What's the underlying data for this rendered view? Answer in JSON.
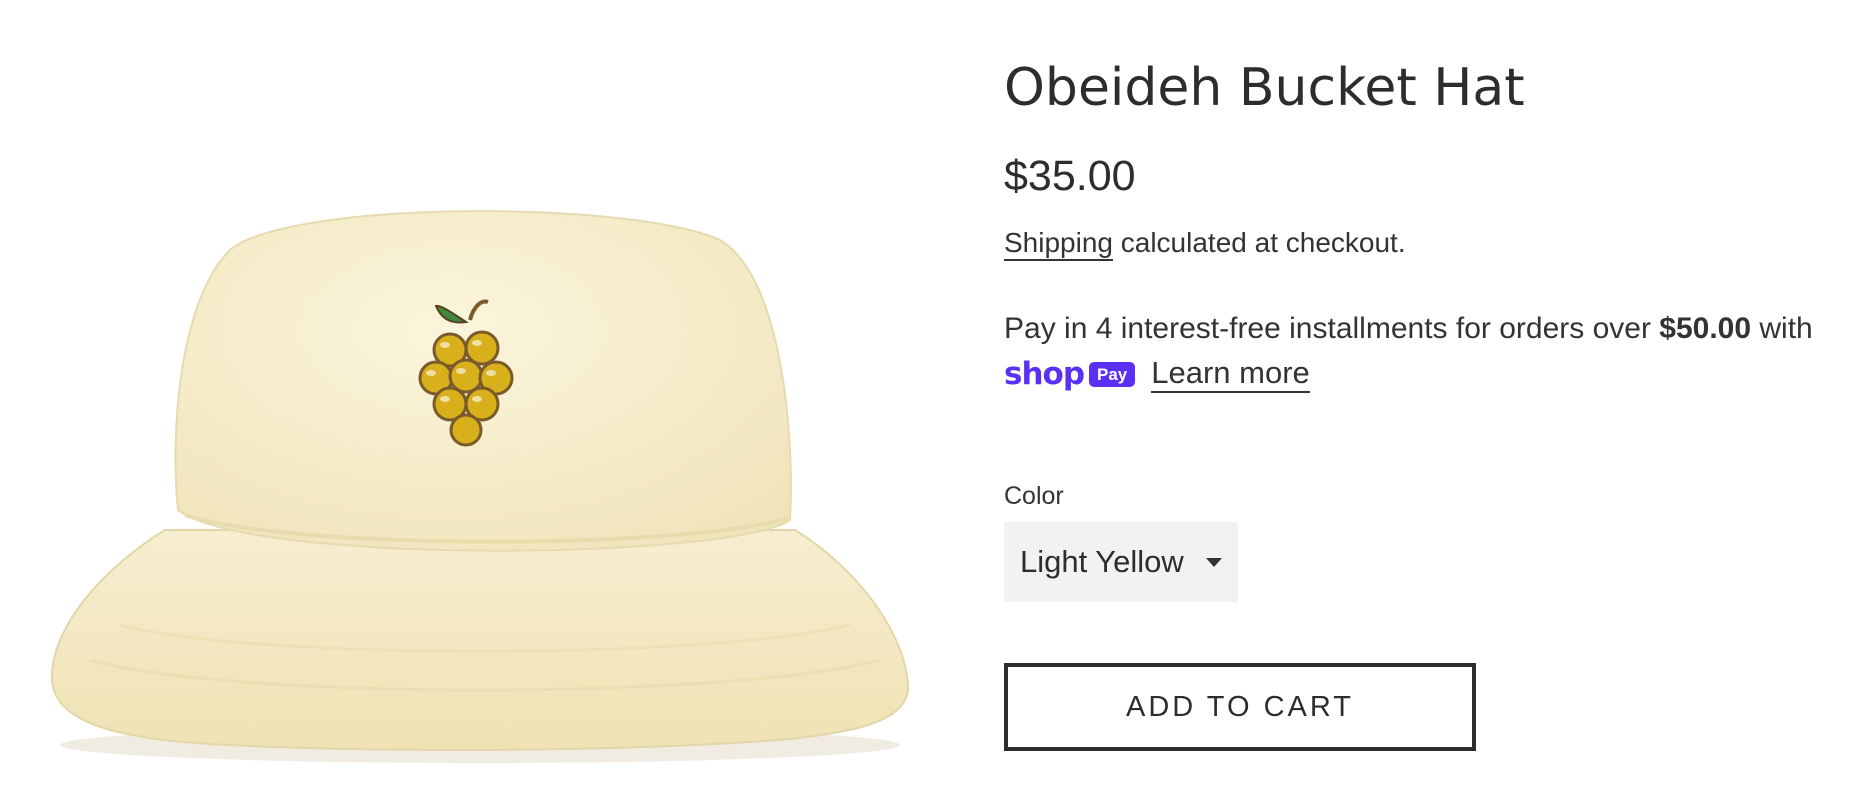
{
  "product": {
    "title": "Obeideh Bucket Hat",
    "price": "$35.00",
    "image_alt": "bucket-hat-with-grape-embroidery",
    "hat_color": "#f8efcf",
    "grape_color": "#d8b01c"
  },
  "shipping": {
    "link_text": "Shipping",
    "rest_text": " calculated at checkout."
  },
  "installments": {
    "text_before": "Pay in 4 interest-free installments for orders over ",
    "threshold": "$50.00",
    "text_after": " with",
    "shop_word": "shop",
    "pay_badge": "Pay",
    "learn_more": "Learn more",
    "brand_color": "#5a31f4"
  },
  "variant": {
    "label": "Color",
    "selected": "Light Yellow",
    "icon": "chevron-down-icon"
  },
  "cart": {
    "button_label": "ADD TO CART"
  }
}
